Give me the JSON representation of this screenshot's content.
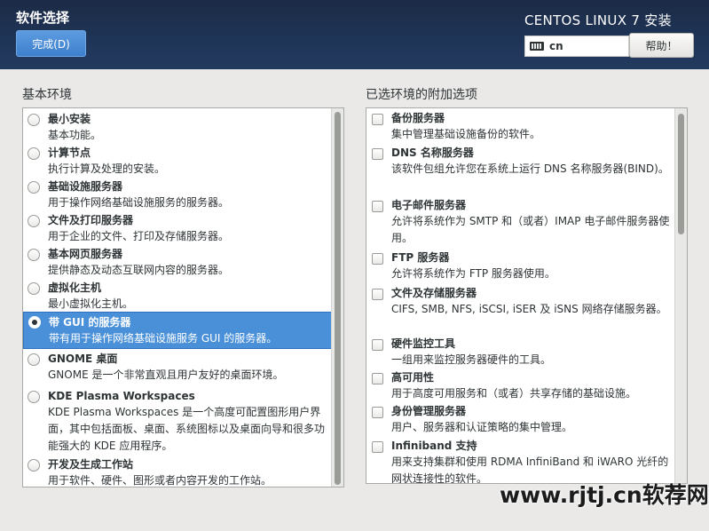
{
  "header": {
    "page_title": "软件选择",
    "done_button": "完成(D)",
    "product_title": "CENTOS LINUX 7 安装",
    "keyboard_layout": "cn",
    "help_button": "帮助！"
  },
  "base_env": {
    "label": "基本环境",
    "selected_index": 6,
    "items": [
      {
        "name": "最小安装",
        "desc": "基本功能。"
      },
      {
        "name": "计算节点",
        "desc": "执行计算及处理的安装。"
      },
      {
        "name": "基础设施服务器",
        "desc": "用于操作网络基础设施服务的服务器。"
      },
      {
        "name": "文件及打印服务器",
        "desc": "用于企业的文件、打印及存储服务器。"
      },
      {
        "name": "基本网页服务器",
        "desc": "提供静态及动态互联网内容的服务器。"
      },
      {
        "name": "虚拟化主机",
        "desc": "最小虚拟化主机。"
      },
      {
        "name": "带 GUI 的服务器",
        "desc": "带有用于操作网络基础设施服务 GUI 的服务器。"
      },
      {
        "name": "GNOME 桌面",
        "desc": "GNOME 是一个非常直观且用户友好的桌面环境。"
      },
      {
        "name": "KDE Plasma Workspaces",
        "desc": "KDE Plasma Workspaces 是一个高度可配置图形用户界面，其中包括面板、桌面、系统图标以及桌面向导和很多功能强大的 KDE 应用程序。"
      },
      {
        "name": "开发及生成工作站",
        "desc": "用于软件、硬件、图形或者内容开发的工作站。"
      }
    ]
  },
  "addons": {
    "label": "已选环境的附加选项",
    "items": [
      {
        "name": "备份服务器",
        "desc": "集中管理基础设施备份的软件。",
        "checked": false
      },
      {
        "name": "DNS 名称服务器",
        "desc": "该软件包组允许您在系统上运行 DNS 名称服务器(BIND)。",
        "checked": false
      },
      {
        "name": "电子邮件服务器",
        "desc": "允许将系统作为 SMTP 和（或者）IMAP 电子邮件服务器使用。",
        "checked": false
      },
      {
        "name": "FTP 服务器",
        "desc": "允许将系统作为 FTP 服务器使用。",
        "checked": false
      },
      {
        "name": "文件及存储服务器",
        "desc": "CIFS, SMB, NFS, iSCSI, iSER 及 iSNS 网络存储服务器。",
        "checked": false
      },
      {
        "name": "硬件监控工具",
        "desc": "一组用来监控服务器硬件的工具。",
        "checked": false
      },
      {
        "name": "高可用性",
        "desc": "用于高度可用服务和（或者）共享存储的基础设施。",
        "checked": false
      },
      {
        "name": "身份管理服务器",
        "desc": "用户、服务器和认证策略的集中管理。",
        "checked": false
      },
      {
        "name": "Infiniband 支持",
        "desc": "用来支持集群和使用 RDMA InfiniBand 和 iWARO 光纤的网状连接性的软件。",
        "checked": false
      }
    ]
  },
  "watermark": "www.rjtj.cn软荐网"
}
